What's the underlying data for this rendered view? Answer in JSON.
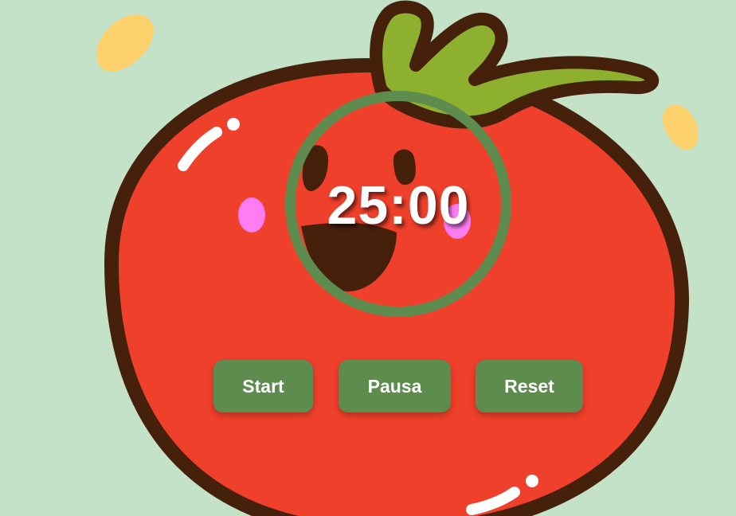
{
  "timer": {
    "display": "25:00"
  },
  "controls": {
    "start_label": "Start",
    "pause_label": "Pausa",
    "reset_label": "Reset"
  },
  "colors": {
    "background": "#c4e2c7",
    "tomato": "#ef402b",
    "outline": "#45200b",
    "stem": "#8db12f",
    "ring": "#5e8c4f",
    "button": "#5e8c4f",
    "cheek": "#ff7cf2",
    "seed": "#fdd16b"
  },
  "icons": {
    "illustration": "tomato-mascot-icon"
  }
}
